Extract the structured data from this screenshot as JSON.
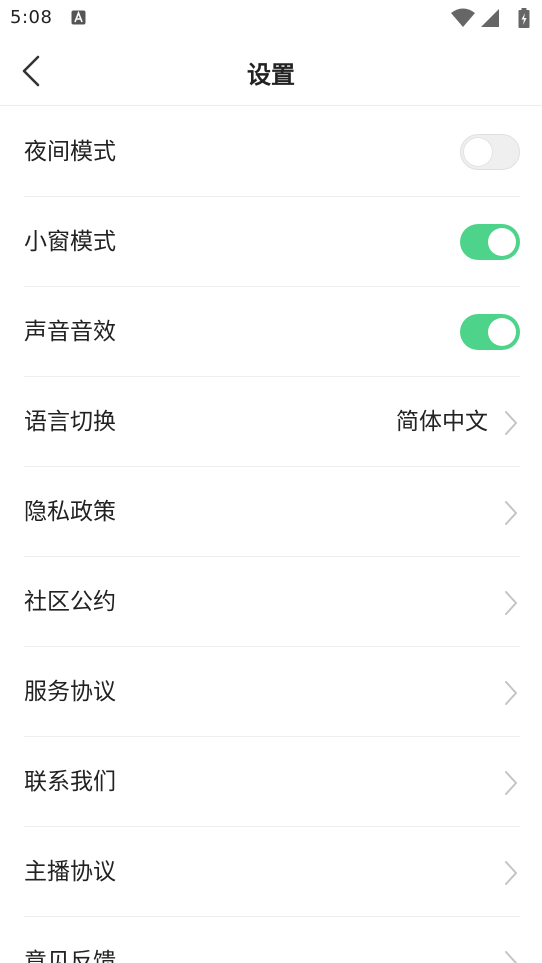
{
  "status_bar": {
    "time": "5:08"
  },
  "nav": {
    "title": "设置"
  },
  "settings": [
    {
      "label": "夜间模式",
      "type": "toggle",
      "on": false
    },
    {
      "label": "小窗模式",
      "type": "toggle",
      "on": true
    },
    {
      "label": "声音音效",
      "type": "toggle",
      "on": true
    },
    {
      "label": "语言切换",
      "type": "link",
      "value": "简体中文"
    },
    {
      "label": "隐私政策",
      "type": "link"
    },
    {
      "label": "社区公约",
      "type": "link"
    },
    {
      "label": "服务协议",
      "type": "link"
    },
    {
      "label": "联系我们",
      "type": "link"
    },
    {
      "label": "主播协议",
      "type": "link"
    },
    {
      "label": "意见反馈",
      "type": "link"
    }
  ],
  "colors": {
    "toggle_on": "#4ed48a",
    "toggle_off": "#efefef",
    "chevron": "#c4c4c4"
  }
}
